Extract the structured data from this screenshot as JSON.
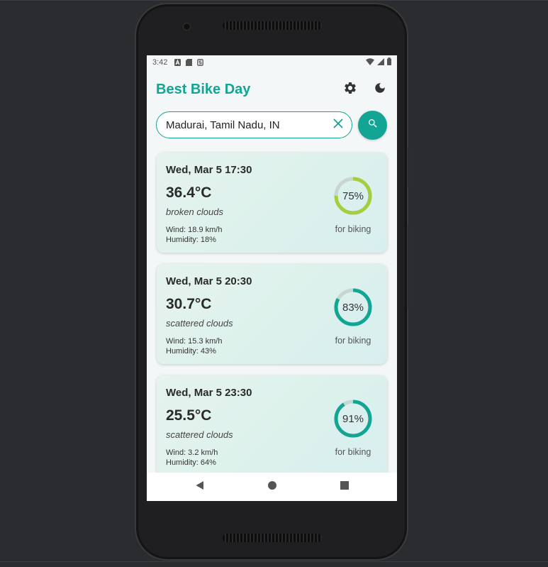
{
  "status_bar": {
    "time": "3:42",
    "left_icons": [
      "a-icon",
      "sd-card-icon",
      "vpn-icon"
    ],
    "right_icons": [
      "wifi-icon",
      "cellular-icon",
      "battery-icon"
    ]
  },
  "app": {
    "title": "Best Bike Day",
    "title_color": "#12a594",
    "accent_color": "#12a594",
    "actions": [
      "settings-icon",
      "dark-mode-icon"
    ]
  },
  "search": {
    "value": "Madurai, Tamil Nadu, IN",
    "clear_icon": "close-icon",
    "button_icon": "search-icon"
  },
  "forecasts": [
    {
      "date": "Wed, Mar 5 17:30",
      "temperature": "36.4°C",
      "description": "broken clouds",
      "wind": "Wind: 18.9 km/h",
      "humidity": "Humidity: 18%",
      "score_text": "75%",
      "score": 75,
      "score_color": "#a5cd3c",
      "score_label": "for biking"
    },
    {
      "date": "Wed, Mar 5 20:30",
      "temperature": "30.7°C",
      "description": "scattered clouds",
      "wind": "Wind: 15.3 km/h",
      "humidity": "Humidity: 43%",
      "score_text": "83%",
      "score": 83,
      "score_color": "#12a594",
      "score_label": "for biking"
    },
    {
      "date": "Wed, Mar 5 23:30",
      "temperature": "25.5°C",
      "description": "scattered clouds",
      "wind": "Wind: 3.2 km/h",
      "humidity": "Humidity: 64%",
      "score_text": "91%",
      "score": 91,
      "score_color": "#12a594",
      "score_label": "for biking"
    }
  ],
  "nav_bar": [
    "back-icon",
    "home-icon",
    "recents-icon"
  ]
}
